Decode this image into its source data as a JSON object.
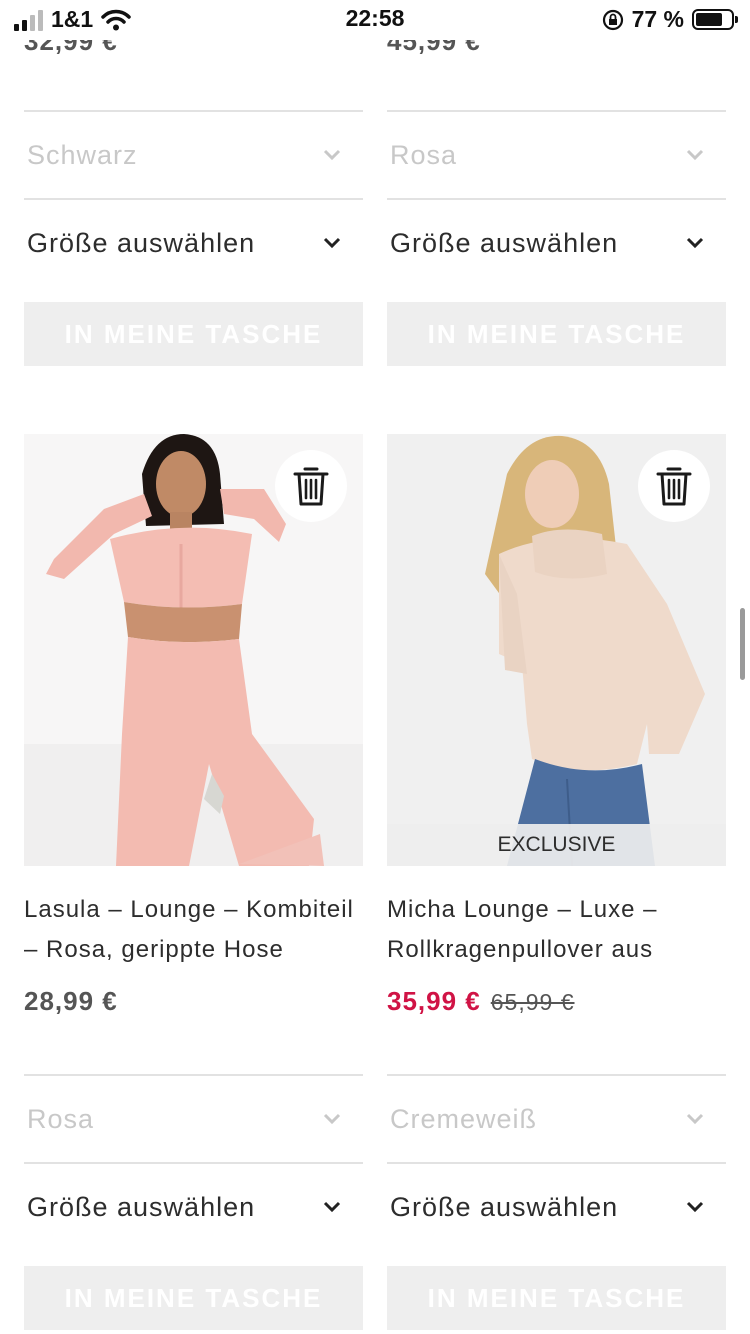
{
  "status_bar": {
    "carrier": "1&1",
    "time": "22:58",
    "battery_pct": "77 %",
    "battery_level": 0.77
  },
  "top_row": {
    "left": {
      "price_partial": "32,99 €",
      "color_select": "Schwarz",
      "size_select": "Größe auswählen",
      "bag_button": "IN MEINE TASCHE"
    },
    "right": {
      "price_partial": "45,99 €",
      "color_select": "Rosa",
      "size_select": "Größe auswählen",
      "bag_button": "IN MEINE TASCHE"
    }
  },
  "products": [
    {
      "title": "Lasula – Lounge – Kombiteil – Rosa, gerippte Hose",
      "price": "28,99 €",
      "color_select": "Rosa",
      "size_select": "Größe auswählen",
      "bag_button": "IN MEINE TASCHE",
      "image_desc": "pink-lounge-set-photo"
    },
    {
      "title": "Micha Lounge – Luxe – Rollkragenpullover aus",
      "badge": "EXCLUSIVE",
      "sale_price": "35,99 €",
      "original_price": "65,99 €",
      "color_select": "Cremeweiß",
      "size_select": "Größe auswählen",
      "bag_button": "IN MEINE TASCHE",
      "image_desc": "cream-turtleneck-sweater-photo"
    }
  ],
  "colors": {
    "sale": "#d01345",
    "disabled_text": "#c8c8c8",
    "button_bg": "#eeeeee"
  }
}
